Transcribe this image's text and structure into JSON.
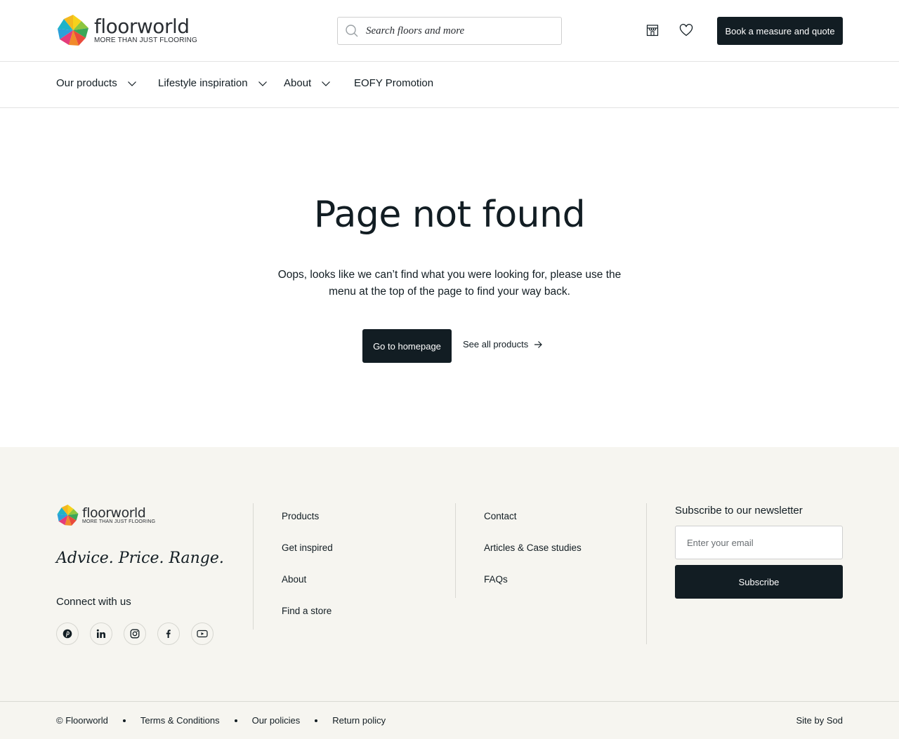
{
  "header": {
    "logo": {
      "word": "floorworld",
      "tagline": "MORE THAN JUST FLOORING"
    },
    "search": {
      "placeholder": "Search floors and more"
    },
    "store_icon": "store-icon",
    "wishlist_icon": "heart-icon",
    "book_label": "Book a measure and quote"
  },
  "nav": {
    "items": [
      {
        "label": "Our products",
        "has_dropdown": true
      },
      {
        "label": "Lifestyle inspiration",
        "has_dropdown": true
      },
      {
        "label": "About",
        "has_dropdown": true
      },
      {
        "label": "EOFY Promotion",
        "has_dropdown": false
      }
    ]
  },
  "main": {
    "title": "Page not found",
    "description": "Oops, looks like we can’t find what you were looking for, please use the menu at the top of the page to find your way back.",
    "home_button": "Go to homepage",
    "all_products_link": "See all products"
  },
  "footer": {
    "logo": {
      "word": "floorworld",
      "tagline": "MORE THAN JUST FLOORING"
    },
    "slogan": "Advice. Price. Range.",
    "connect_label": "Connect with us",
    "socials": [
      "pinterest-icon",
      "linkedin-icon",
      "instagram-icon",
      "facebook-icon",
      "youtube-icon"
    ],
    "col1": [
      "Products",
      "Get inspired",
      "About",
      "Find a store"
    ],
    "col2": [
      "Contact",
      "Articles & Case studies",
      "FAQs"
    ],
    "newsletter": {
      "title": "Subscribe to our newsletter",
      "placeholder": "Enter your email",
      "button": "Subscribe"
    },
    "bottom": {
      "copyright": "© Floorworld",
      "links": [
        "Terms & Conditions",
        "Our policies",
        "Return policy"
      ],
      "site_by": "Site by Sod"
    }
  },
  "colors": {
    "dark": "#121d23",
    "footer_bg": "#f6f5f0",
    "border": "#e3e3e3"
  }
}
